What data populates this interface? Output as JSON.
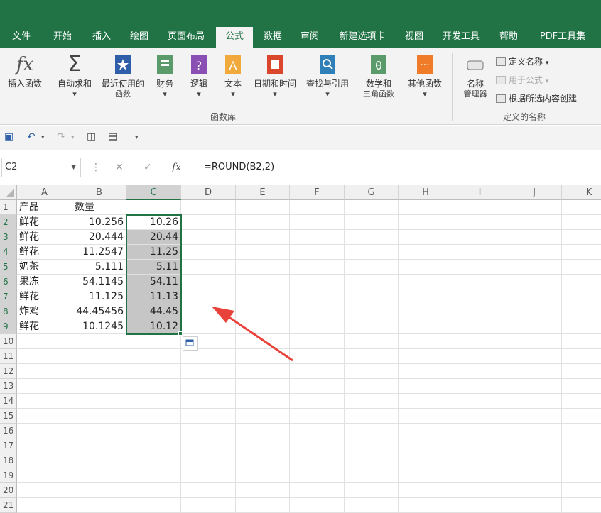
{
  "tabs": [
    "文件",
    "开始",
    "插入",
    "绘图",
    "页面布局",
    "公式",
    "数据",
    "审阅",
    "新建选项卡",
    "视图",
    "开发工具",
    "帮助",
    "PDF工具集"
  ],
  "active_tab": "公式",
  "ribbon": {
    "insert_function": "插入函数",
    "autosum": "自动求和",
    "recent": "最近使用的",
    "recent2": "函数",
    "financial": "财务",
    "logical": "逻辑",
    "text": "文本",
    "datetime": "日期和时间",
    "lookup": "查找与引用",
    "math": "数学和",
    "math2": "三角函数",
    "more": "其他函数",
    "group_library": "函数库",
    "name_mgr": "名称",
    "name_mgr2": "管理器",
    "define_name": "定义名称",
    "use_in_formula": "用于公式",
    "create_from_sel": "根据所选内容创建",
    "group_defined": "定义的名称",
    "icon_fx": "fx",
    "icon_sigma": "Σ"
  },
  "formula_bar": {
    "name_box": "C2",
    "fx_label": "fx",
    "formula": "=ROUND(B2,2)"
  },
  "columns": [
    "A",
    "B",
    "C",
    "D",
    "E",
    "F",
    "G",
    "H",
    "I",
    "J",
    "K"
  ],
  "rows": [
    "1",
    "2",
    "3",
    "4",
    "5",
    "6",
    "7",
    "8",
    "9",
    "10",
    "11",
    "12",
    "13",
    "14",
    "15",
    "16",
    "17",
    "18",
    "19",
    "20",
    "21"
  ],
  "sheet": {
    "header": [
      "产品",
      "数量",
      ""
    ],
    "data": [
      [
        "鲜花",
        "10.256",
        "10.26"
      ],
      [
        "鲜花",
        "20.444",
        "20.44"
      ],
      [
        "鲜花",
        "11.2547",
        "11.25"
      ],
      [
        "奶茶",
        "5.111",
        "5.11"
      ],
      [
        "果冻",
        "54.1145",
        "54.11"
      ],
      [
        "鲜花",
        "11.125",
        "11.13"
      ],
      [
        "炸鸡",
        "44.45456",
        "44.45"
      ],
      [
        "鲜花",
        "10.1245",
        "10.12"
      ]
    ]
  },
  "colors": {
    "accent": "#217346",
    "arrow": "#e8423a",
    "selection_fill": "#c6c6c6"
  }
}
